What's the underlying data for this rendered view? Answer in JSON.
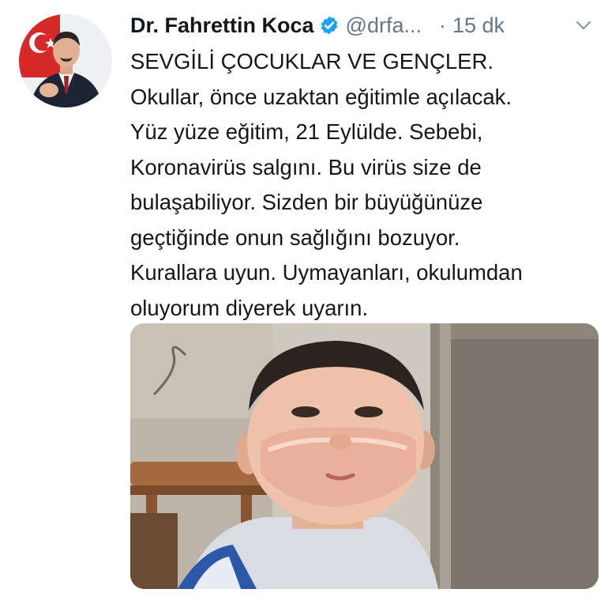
{
  "tweet": {
    "author": {
      "name": "Dr. Fahrettin Koca",
      "handle": "@drfa...",
      "verified": true
    },
    "separator": "·",
    "timestamp": "15 dk",
    "icons": {
      "verified": "verified-badge-icon",
      "menu": "chevron-down-icon"
    },
    "text_lines": [
      "SEVGİLİ ÇOCUKLAR VE GENÇLER.",
      "Okullar, önce uzaktan eğitimle açılacak.",
      "Yüz yüze eğitim, 21 Eylülde. Sebebi,",
      "Koronavirüs salgını. Bu virüs size de",
      "bulaşabiliyor. Sizden bir büyüğünüze",
      "geçtiğinde onun sağlığını bozuyor.",
      "Kurallara uyun. Uymayanları, okulumdan",
      "oluyorum diyerek uyarın."
    ],
    "colors": {
      "text": "#14171a",
      "secondary": "#657786",
      "verified": "#1da1f2"
    }
  }
}
